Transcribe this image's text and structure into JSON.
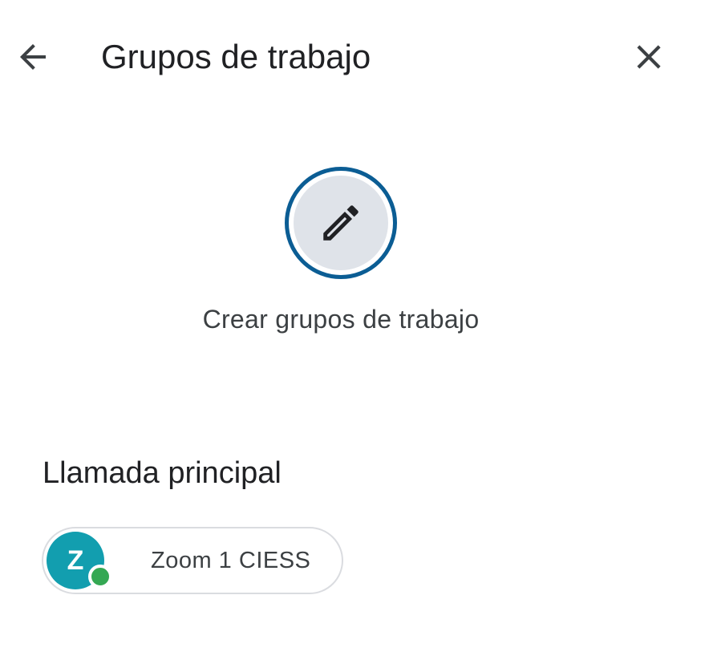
{
  "header": {
    "back_icon": "arrow-back-icon",
    "title": "Grupos de trabajo",
    "close_icon": "close-icon"
  },
  "create": {
    "icon": "pencil-edit-icon",
    "label": "Crear grupos de trabajo",
    "ring_color": "#0b5d94",
    "fill_color": "#dfe3e9"
  },
  "main_call": {
    "heading": "Llamada principal",
    "participants": [
      {
        "initial": "Z",
        "name": "Zoom 1 CIESS",
        "avatar_color": "#129eaf",
        "presence": "online",
        "presence_color": "#34a853"
      }
    ]
  }
}
